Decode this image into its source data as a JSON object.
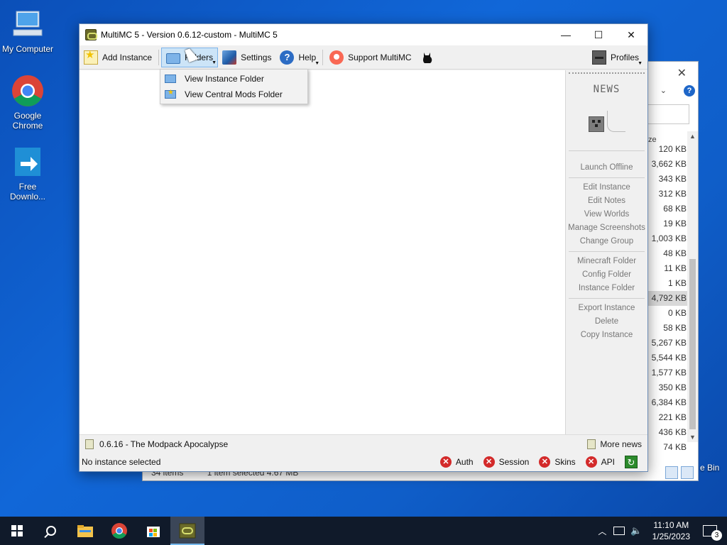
{
  "desktop": {
    "icons": [
      {
        "label": "My Computer"
      },
      {
        "label": "Google Chrome"
      },
      {
        "label": "Free Downlo..."
      }
    ],
    "recycle_bin_label": "e Bin"
  },
  "explorer": {
    "column_header": "ze",
    "sizes": [
      "120 KB",
      "3,662 KB",
      "343 KB",
      "312 KB",
      "68 KB",
      "19 KB",
      "1,003 KB",
      "48 KB",
      "11 KB",
      "1 KB",
      "4,792 KB",
      "0 KB",
      "58 KB",
      "5,267 KB",
      "5,544 KB",
      "1,577 KB",
      "350 KB",
      "6,384 KB",
      "221 KB",
      "436 KB",
      "74 KB"
    ],
    "selected_index": 10,
    "status_items": "34 items",
    "status_selected": "1 item selected  4.67 MB"
  },
  "window": {
    "title": "MultiMC 5 - Version 0.6.12-custom - MultiMC 5",
    "controls": {
      "minimize": "—",
      "maximize": "☐",
      "close": "✕"
    }
  },
  "toolbar": {
    "add_instance": "Add Instance",
    "folders": "Folders",
    "settings": "Settings",
    "help": "Help",
    "support": "Support MultiMC",
    "profiles": "Profiles"
  },
  "folders_menu": {
    "items": [
      "View Instance Folder",
      "View Central Mods Folder"
    ]
  },
  "sidebar": {
    "news_label": "NEWS",
    "groups": [
      [
        "Launch Offline"
      ],
      [
        "Edit Instance",
        "Edit Notes",
        "View Worlds",
        "Manage Screenshots",
        "Change Group"
      ],
      [
        "Minecraft Folder",
        "Config Folder",
        "Instance Folder"
      ],
      [
        "Export Instance",
        "Delete",
        "Copy Instance"
      ]
    ]
  },
  "news_bar": {
    "latest": "0.6.16 - The Modpack Apocalypse",
    "more": "More news"
  },
  "status": {
    "message": "No instance selected",
    "indicators": [
      "Auth",
      "Session",
      "Skins",
      "API"
    ]
  },
  "taskbar": {
    "time": "11:10 AM",
    "date": "1/25/2023",
    "notification_count": "3"
  }
}
